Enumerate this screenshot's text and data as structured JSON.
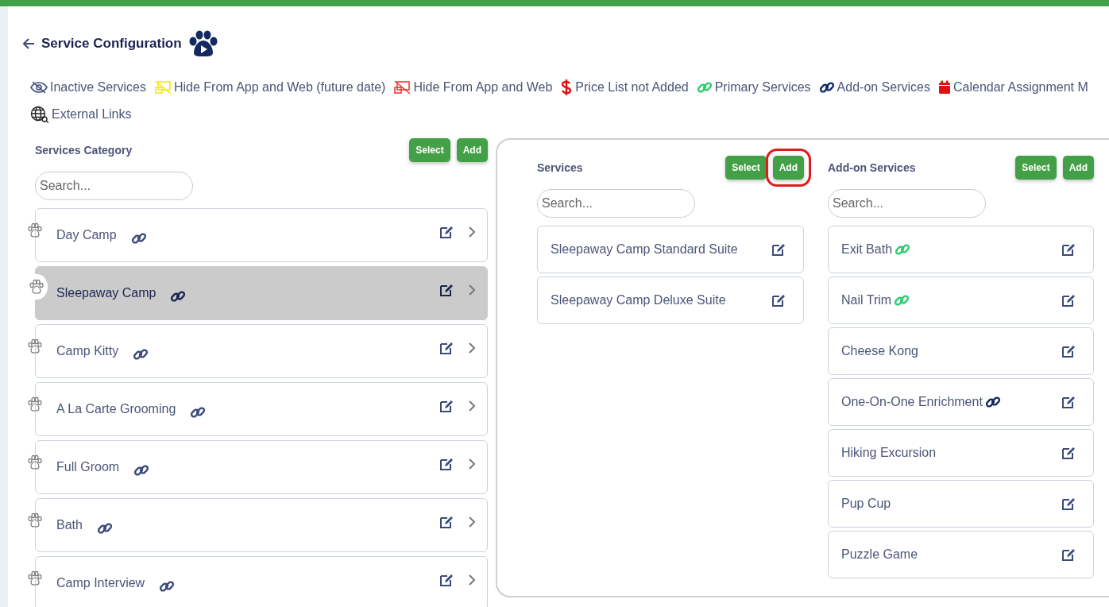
{
  "header": {
    "title": "Service Configuration"
  },
  "legend": [
    {
      "kind": "inactive",
      "label": "Inactive Services"
    },
    {
      "kind": "hide-future",
      "label": "Hide From App and Web (future date)"
    },
    {
      "kind": "hide",
      "label": "Hide From App and Web"
    },
    {
      "kind": "price",
      "label": "Price List not Added"
    },
    {
      "kind": "primary",
      "label": "Primary Services"
    },
    {
      "kind": "addon",
      "label": "Add-on Services"
    },
    {
      "kind": "calendar",
      "label": "Calendar Assignment M"
    },
    {
      "kind": "external",
      "label": "External Links"
    }
  ],
  "categories": {
    "title": "Services Category",
    "buttons": [
      {
        "label": "Select",
        "highlighted": false
      },
      {
        "label": "Add",
        "highlighted": false
      }
    ],
    "search": {
      "placeholder": "Search..."
    },
    "items": [
      {
        "name": "Day Camp",
        "selected": false
      },
      {
        "name": "Sleepaway Camp",
        "selected": true
      },
      {
        "name": "Camp Kitty",
        "selected": false
      },
      {
        "name": "A La Carte Grooming",
        "selected": false
      },
      {
        "name": "Full Groom",
        "selected": false
      },
      {
        "name": "Bath",
        "selected": false
      },
      {
        "name": "Camp Interview",
        "selected": false
      }
    ]
  },
  "services": {
    "title": "Services",
    "buttons": [
      {
        "label": "Select",
        "highlighted": false
      },
      {
        "label": "Add",
        "highlighted": true
      }
    ],
    "search": {
      "placeholder": "Search..."
    },
    "items": [
      {
        "name": "Sleepaway Camp Standard Suite"
      },
      {
        "name": "Sleepaway Camp Deluxe Suite"
      }
    ]
  },
  "addons": {
    "title": "Add-on Services",
    "buttons": [
      {
        "label": "Select",
        "highlighted": false
      },
      {
        "label": "Add",
        "highlighted": false
      }
    ],
    "search": {
      "placeholder": "Search..."
    },
    "items": [
      {
        "name": "Exit Bath",
        "kind": "primary"
      },
      {
        "name": "Nail Trim",
        "kind": "primary"
      },
      {
        "name": "Cheese Kong",
        "kind": "plain"
      },
      {
        "name": "One-On-One Enrichment",
        "kind": "addon"
      },
      {
        "name": "Hiking Excursion",
        "kind": "plain"
      },
      {
        "name": "Pup Cup",
        "kind": "plain"
      },
      {
        "name": "Puzzle Game",
        "kind": "plain"
      }
    ]
  }
}
